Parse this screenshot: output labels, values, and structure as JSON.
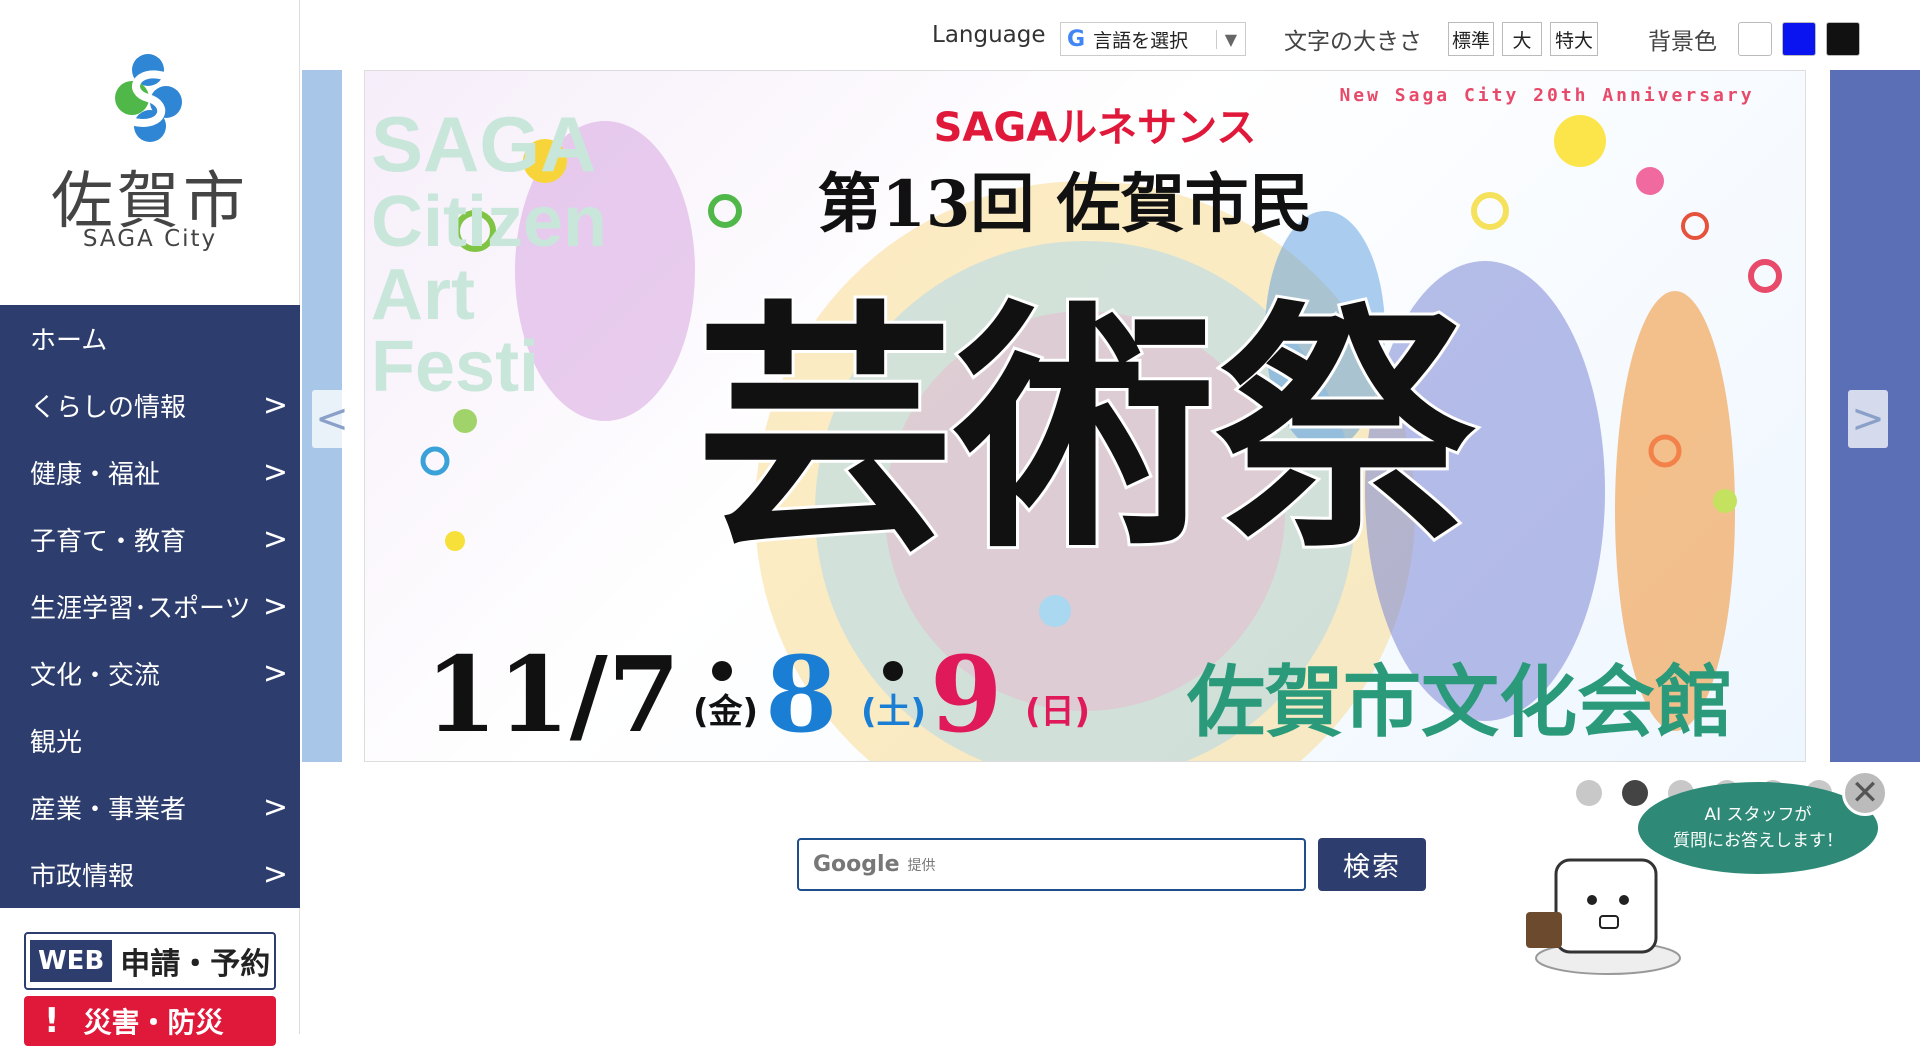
{
  "logo": {
    "name_jp": "佐賀市",
    "name_en": "SAGA City"
  },
  "nav": {
    "items": [
      {
        "label": "ホーム",
        "chevron": ""
      },
      {
        "label": "くらしの情報",
        "chevron": ">"
      },
      {
        "label": "健康・福祉",
        "chevron": ">"
      },
      {
        "label": "子育て・教育",
        "chevron": ">"
      },
      {
        "label": "生涯学習･スポーツ",
        "chevron": ">"
      },
      {
        "label": "文化・交流",
        "chevron": ">"
      },
      {
        "label": "観光",
        "chevron": ""
      },
      {
        "label": "産業・事業者",
        "chevron": ">"
      },
      {
        "label": "市政情報",
        "chevron": ">"
      }
    ]
  },
  "quick_links": {
    "web_tag": "WEB",
    "web_label": "申請・予約",
    "disaster_mark": "!",
    "disaster_label": "災害・防災"
  },
  "topbar": {
    "language_label": "Language",
    "language_select": "言語を選択",
    "language_arrow": "▼",
    "google_icon": "G",
    "font_size_label": "文字の大きさ",
    "font_sizes": [
      "標準",
      "大",
      "特大"
    ],
    "bg_label": "背景色",
    "bg_colors": [
      "#ffffff",
      "#0a14f0",
      "#111111"
    ]
  },
  "slider": {
    "prev_arrow": "<",
    "next_arrow": ">",
    "banner": {
      "anniversary": "New Saga City 20th Anniversary",
      "series": "SAGAルネサンス",
      "edition": "第13回 佐賀市民",
      "title": "芸術祭",
      "bg_text": "SAGA Citizen Art Festi",
      "date_main": "11/7",
      "date_day1": "(金)",
      "date_2": "8",
      "date_day2": "(土)",
      "date_3": "9",
      "date_day3": "(日)",
      "venue": "佐賀市文化会館"
    },
    "dot_count": 7,
    "active_dot": 1
  },
  "search": {
    "google_word": "Google",
    "google_sub": "提供",
    "button_label": "検索"
  },
  "assistant": {
    "line1": "AI スタッフが",
    "line2": "質問にお答えします！",
    "close": "✕"
  },
  "colors": {
    "nav_bg": "#2d3e6e",
    "accent_red": "#e0193a",
    "date_blue": "#1a7fd4",
    "date_pink": "#e0195a",
    "venue_green": "#2a9a7a"
  }
}
